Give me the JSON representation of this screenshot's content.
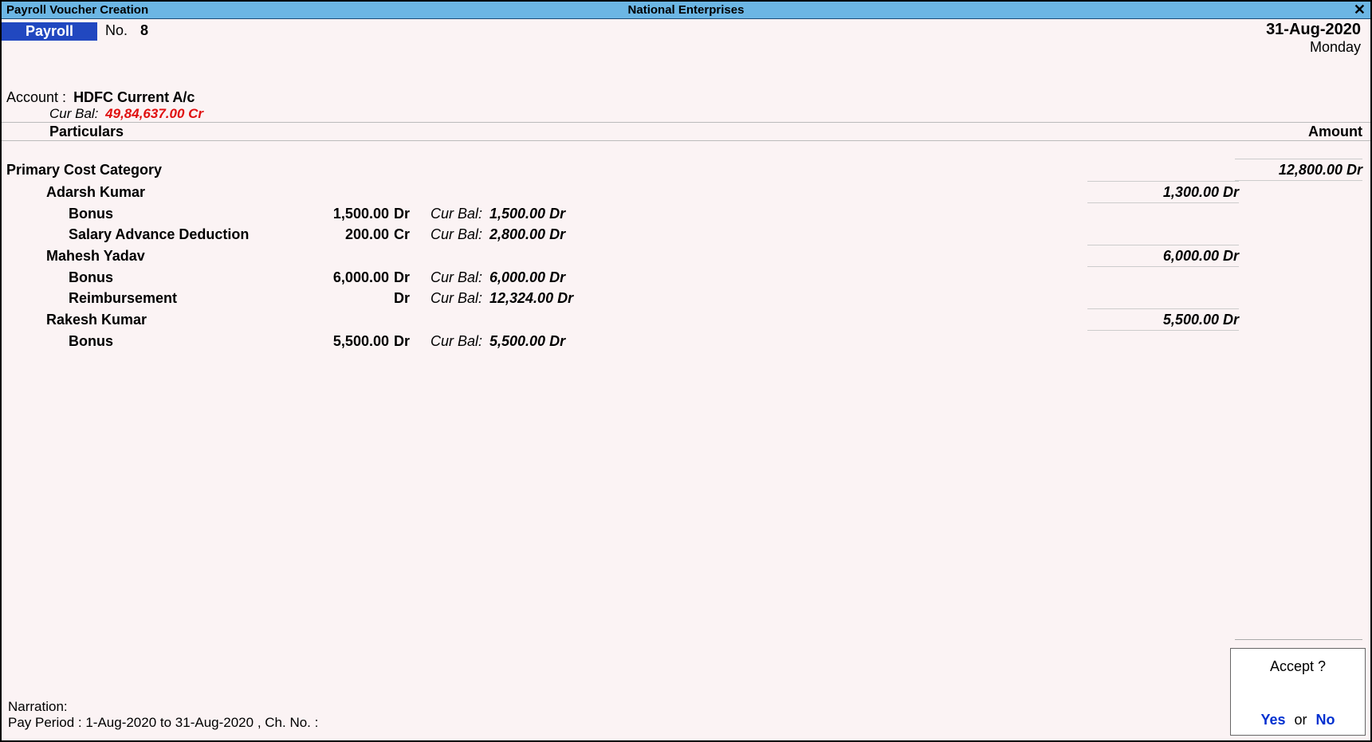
{
  "titlebar": {
    "left": "Payroll Voucher Creation",
    "center": "National Enterprises",
    "close": "✕"
  },
  "voucher": {
    "type": "Payroll",
    "no_label": "No.",
    "no_value": "8",
    "date": "31-Aug-2020",
    "day": "Monday"
  },
  "account": {
    "label": "Account :",
    "name": "HDFC Current A/c",
    "curbal_label": "Cur Bal:",
    "curbal_value": "49,84,637.00 Cr"
  },
  "headers": {
    "particulars": "Particulars",
    "amount": "Amount"
  },
  "category": {
    "name": "Primary Cost Category",
    "amount": "12,800.00 Dr"
  },
  "employees": [
    {
      "name": "Adarsh Kumar",
      "amount": "1,300.00 Dr",
      "payheads": [
        {
          "name": "Bonus",
          "amt": "1,500.00",
          "drcr": "Dr",
          "curbal_label": "Cur Bal:",
          "curbal_value": "1,500.00 Dr"
        },
        {
          "name": "Salary Advance Deduction",
          "amt": "200.00",
          "drcr": "Cr",
          "curbal_label": "Cur Bal:",
          "curbal_value": "2,800.00 Dr"
        }
      ]
    },
    {
      "name": "Mahesh Yadav",
      "amount": "6,000.00 Dr",
      "payheads": [
        {
          "name": "Bonus",
          "amt": "6,000.00",
          "drcr": "Dr",
          "curbal_label": "Cur Bal:",
          "curbal_value": "6,000.00 Dr"
        },
        {
          "name": "Reimbursement",
          "amt": "",
          "drcr": "Dr",
          "curbal_label": "Cur Bal:",
          "curbal_value": "12,324.00 Dr"
        }
      ]
    },
    {
      "name": "Rakesh Kumar",
      "amount": "5,500.00 Dr",
      "payheads": [
        {
          "name": "Bonus",
          "amt": "5,500.00",
          "drcr": "Dr",
          "curbal_label": "Cur Bal:",
          "curbal_value": "5,500.00 Dr"
        }
      ]
    }
  ],
  "narration": {
    "label": "Narration:",
    "text": "Pay Period : 1-Aug-2020 to 31-Aug-2020 , Ch. No. :"
  },
  "accept": {
    "title": "Accept ?",
    "yes": "Yes",
    "or": "or",
    "no": "No"
  }
}
